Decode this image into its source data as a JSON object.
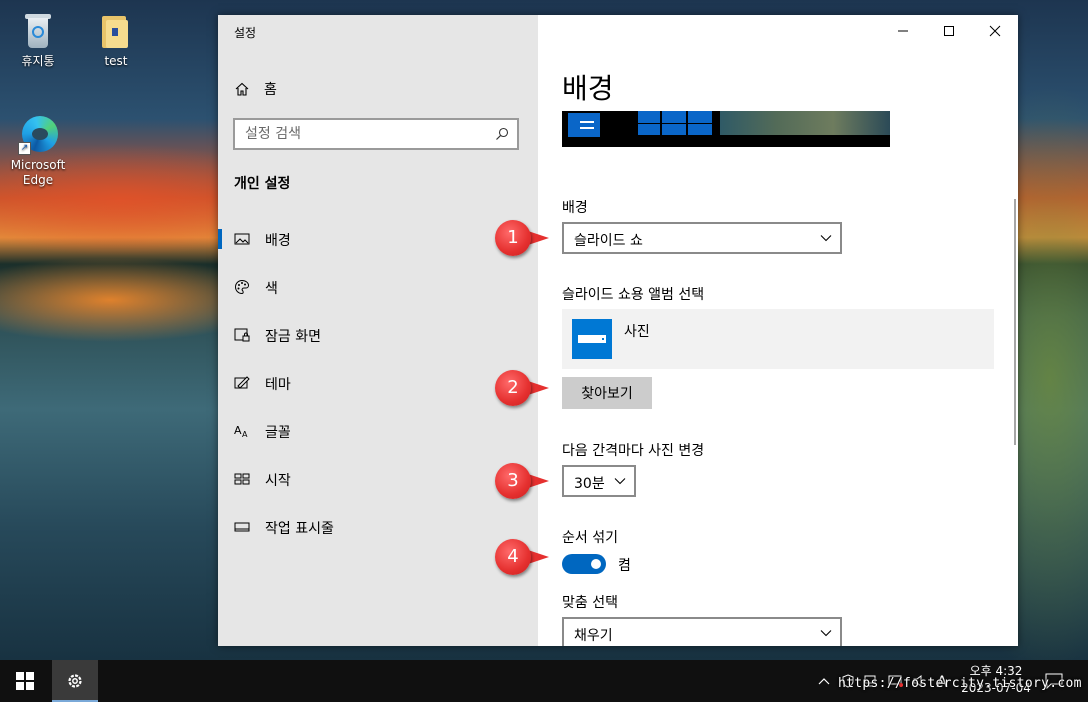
{
  "desktop": {
    "icons": [
      {
        "label": "휴지통"
      },
      {
        "label": "test"
      },
      {
        "label": "Microsoft\nEdge",
        "line1": "Microsoft",
        "line2": "Edge"
      }
    ]
  },
  "window": {
    "title": "설정",
    "sidebar": {
      "home_label": "홈",
      "search_placeholder": "설정 검색",
      "section_title": "개인 설정",
      "items": [
        {
          "label": "배경",
          "icon": "picture-icon",
          "selected": true
        },
        {
          "label": "색",
          "icon": "palette-icon"
        },
        {
          "label": "잠금 화면",
          "icon": "lock-screen-icon"
        },
        {
          "label": "테마",
          "icon": "theme-icon"
        },
        {
          "label": "글꼴",
          "icon": "font-icon"
        },
        {
          "label": "시작",
          "icon": "start-icon"
        },
        {
          "label": "작업 표시줄",
          "icon": "taskbar-icon"
        }
      ]
    },
    "content": {
      "page_title": "배경",
      "background_label": "배경",
      "background_value": "슬라이드 쇼",
      "album_label": "슬라이드 쇼용 앨범 선택",
      "album_name": "사진",
      "browse_button": "찾아보기",
      "interval_label": "다음 간격마다 사진 변경",
      "interval_value": "30분",
      "shuffle_label": "순서 섞기",
      "shuffle_state": "켬",
      "shuffle_on": true,
      "fit_label": "맞춤 선택",
      "fit_value": "채우기"
    }
  },
  "annotations": [
    "1",
    "2",
    "3",
    "4"
  ],
  "taskbar": {
    "time": "오후 4:32",
    "date": "2023-07-04",
    "ime": "A",
    "watermark": "https://fostercity.tistory.com"
  },
  "colors": {
    "accent": "#0067c0",
    "callout": "#e5302f",
    "sidebar_bg": "#e6e6e6",
    "taskbar_bg": "#101010"
  }
}
